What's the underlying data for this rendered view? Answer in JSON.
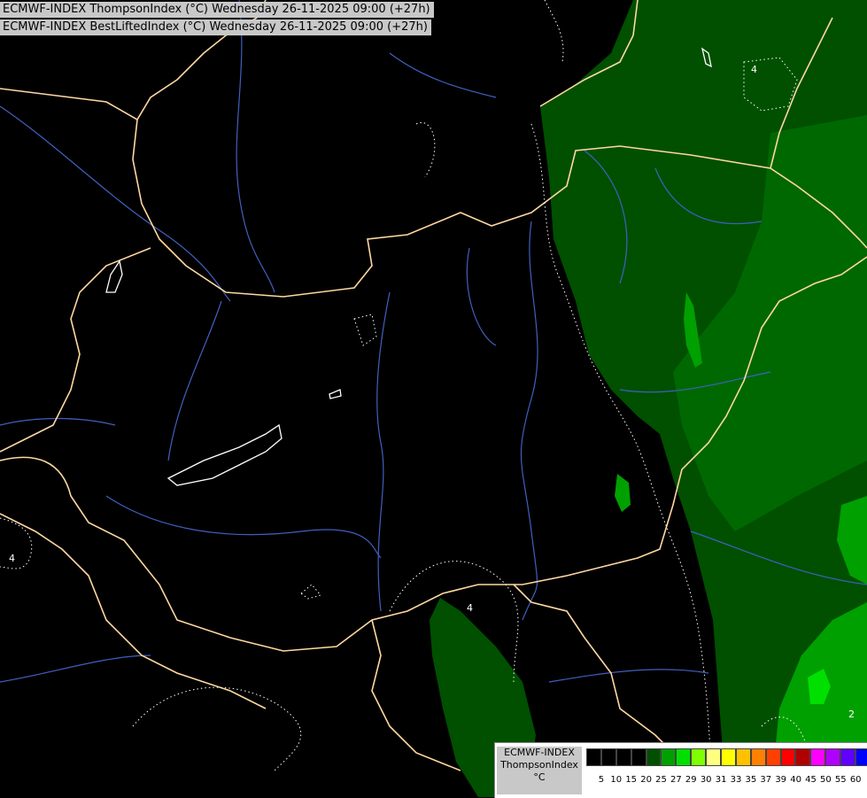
{
  "titles": {
    "line1": "ECMWF-INDEX ThompsonIndex (°C) Wednesday 26-11-2025 09:00 (+27h)",
    "line2": "ECMWF-INDEX BestLiftedIndex (°C) Wednesday 26-11-2025 09:00 (+27h)"
  },
  "legend": {
    "model": "ECMWF-INDEX",
    "parameter": "ThompsonIndex",
    "unit": "°C",
    "ticks": [
      "5",
      "10",
      "15",
      "20",
      "25",
      "27",
      "29",
      "30",
      "31",
      "33",
      "35",
      "37",
      "39",
      "40",
      "45",
      "50",
      "55",
      "60"
    ],
    "colors": [
      "#000000",
      "#000000",
      "#000000",
      "#000000",
      "#005000",
      "#00a000",
      "#00e000",
      "#80ff00",
      "#ffff80",
      "#ffff00",
      "#ffc000",
      "#ff8000",
      "#ff4000",
      "#ff0000",
      "#b00000",
      "#ff00ff",
      "#b000ff",
      "#6000ff",
      "#0000ff"
    ]
  },
  "contour_labels": [
    "4",
    "4",
    "4",
    "2"
  ],
  "colors": {
    "background": "#000000",
    "fill_dark_green": "#005000",
    "fill_green": "#00a000",
    "fill_bright_green": "#00e000",
    "borders": "#ffd8a0",
    "rivers": "#4060c0",
    "contours": "#ffffff"
  }
}
